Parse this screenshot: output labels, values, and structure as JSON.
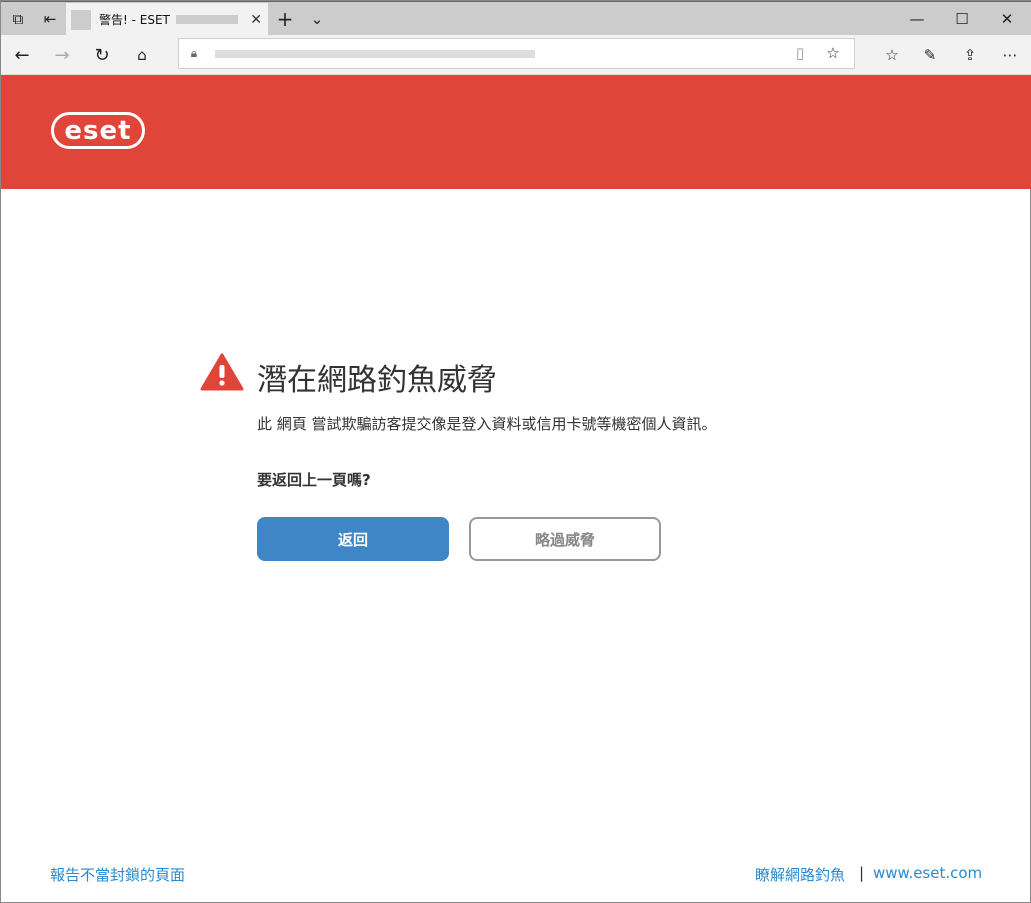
{
  "browser": {
    "tab_title": "警告! - ESET",
    "window_controls": [
      "minimize",
      "maximize",
      "close"
    ]
  },
  "brand": {
    "logo": "eset",
    "color": "#e0453a",
    "button_color": "#3f86c7"
  },
  "main": {
    "title": "潛在網路釣魚威脅",
    "description": "此 網頁 嘗試欺騙訪客提交像是登入資料或信用卡號等機密個人資訊。",
    "question": "要返回上一頁嗎?",
    "back_button": "返回",
    "skip_button": "略過威脅"
  },
  "footer": {
    "report_link": "報告不當封鎖的頁面",
    "learn_link": "瞭解網路釣魚",
    "separator": "|",
    "site_link": "www.eset.com"
  }
}
